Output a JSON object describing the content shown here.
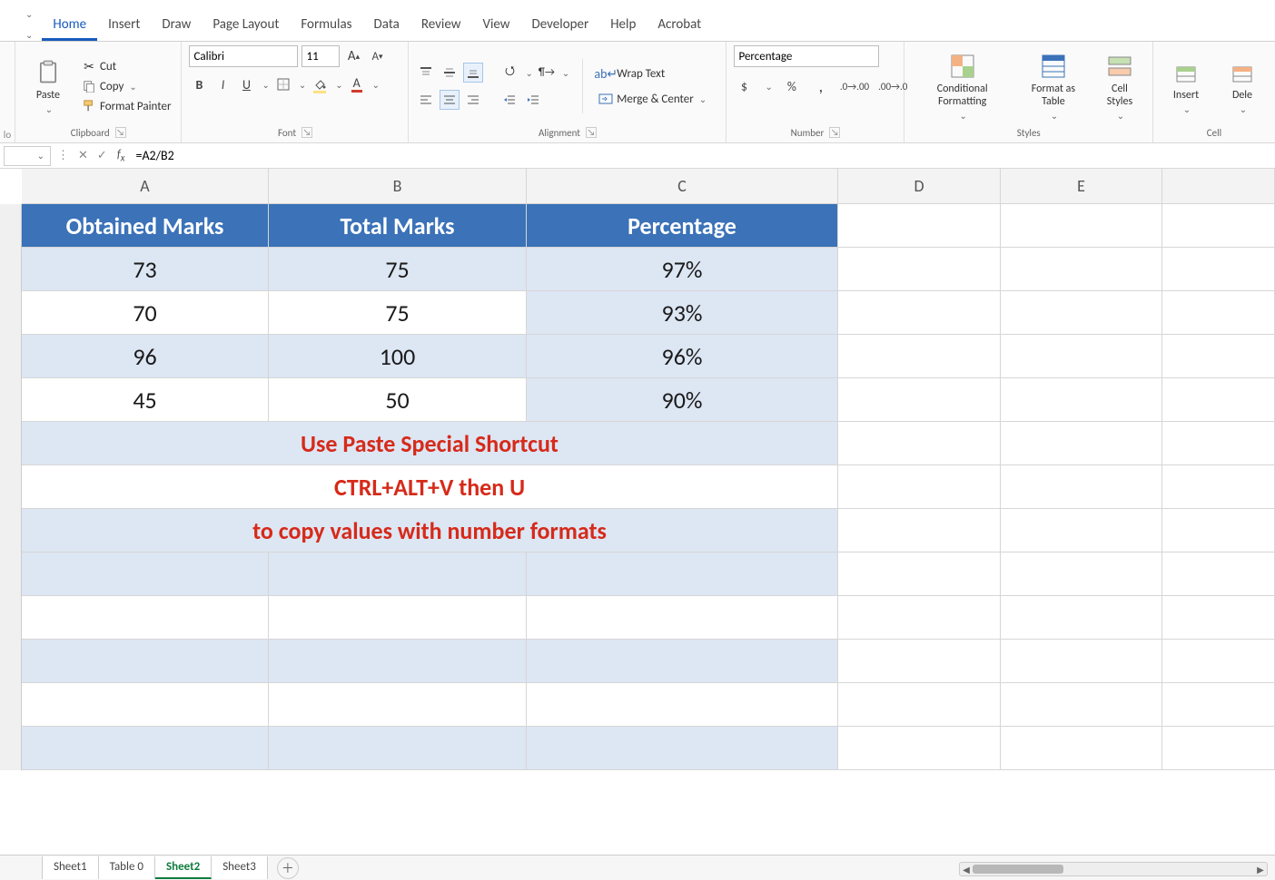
{
  "ribbonTabs": [
    "Home",
    "Insert",
    "Draw",
    "Page Layout",
    "Formulas",
    "Data",
    "Review",
    "View",
    "Developer",
    "Help",
    "Acrobat"
  ],
  "activeRibbonTab": "Home",
  "clipboard": {
    "cut": "Cut",
    "copy": "Copy",
    "formatPainter": "Format Painter",
    "paste": "Paste",
    "groupLabel": "Clipboard"
  },
  "font": {
    "name": "Calibri",
    "size": "11",
    "groupLabel": "Font"
  },
  "alignment": {
    "wrap": "Wrap Text",
    "merge": "Merge & Center",
    "groupLabel": "Alignment"
  },
  "number": {
    "format": "Percentage",
    "groupLabel": "Number"
  },
  "styles": {
    "cond": "Conditional Formatting",
    "formatAs": "Format as Table",
    "cellStyles": "Cell Styles",
    "groupLabel": "Styles"
  },
  "cells": {
    "insert": "Insert",
    "delete": "Dele",
    "groupLabel": "Cell"
  },
  "formulaBar": {
    "formula": "=A2/B2"
  },
  "columns": [
    "A",
    "B",
    "C",
    "D",
    "E"
  ],
  "table": {
    "headers": [
      "Obtained Marks",
      "Total Marks",
      "Percentage"
    ],
    "rows": [
      {
        "a": "73",
        "b": "75",
        "c": "97%"
      },
      {
        "a": "70",
        "b": "75",
        "c": "93%"
      },
      {
        "a": "96",
        "b": "100",
        "c": "96%"
      },
      {
        "a": "45",
        "b": "50",
        "c": "90%"
      }
    ],
    "notes": [
      "Use Paste Special Shortcut",
      "CTRL+ALT+V then U",
      "to copy values with number formats"
    ]
  },
  "sheets": [
    "Sheet1",
    "Table 0",
    "Sheet2",
    "Sheet3"
  ],
  "activeSheet": "Sheet2"
}
